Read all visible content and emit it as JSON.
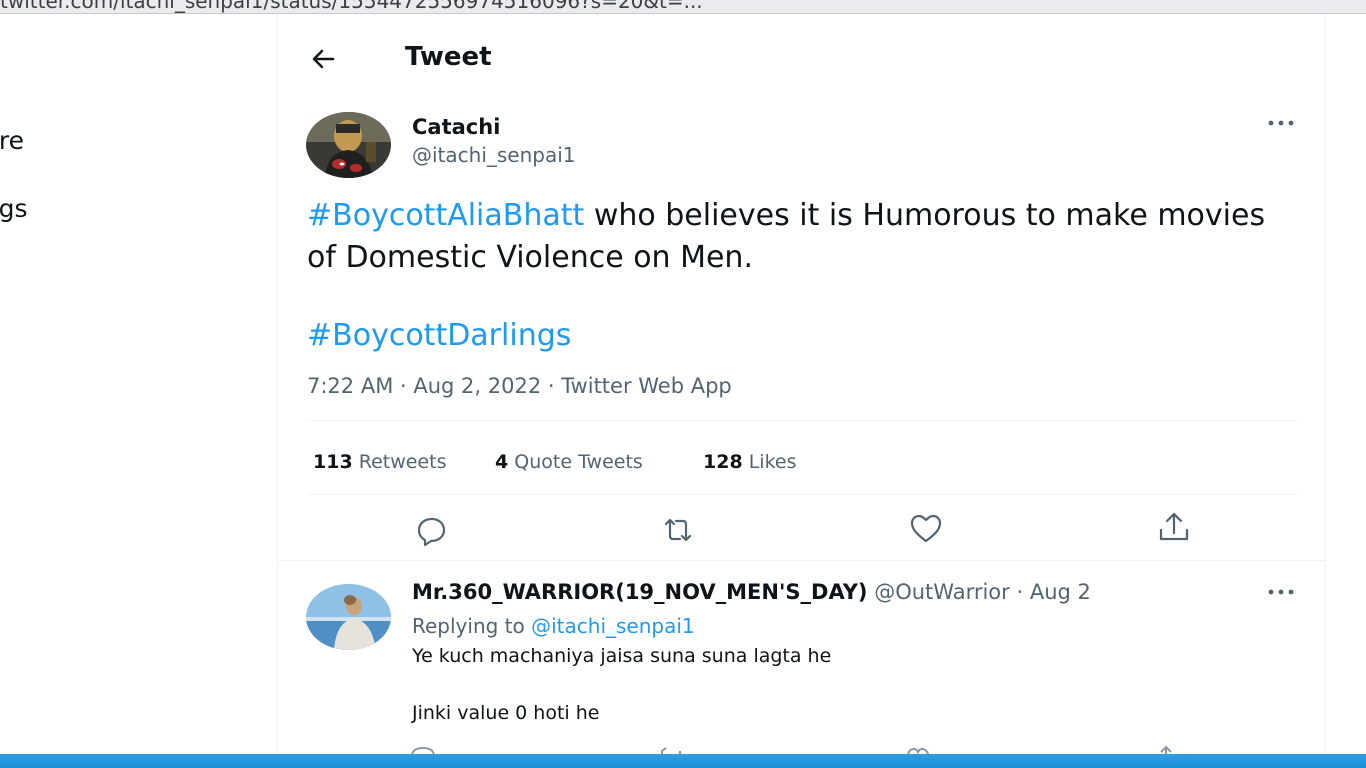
{
  "browser": {
    "url": "twitter.com/itachi_senpai1/status/1554472556974516096?s=20&t=..."
  },
  "left_nav": {
    "items": [
      {
        "label": "More"
      },
      {
        "label": "Settings"
      }
    ]
  },
  "header": {
    "title": "Tweet",
    "back_icon": "arrow-left-icon"
  },
  "tweet": {
    "author_name": "Catachi",
    "author_handle": "@itachi_senpai1",
    "hashtag1": "#BoycottAliaBhatt",
    "text_part1": " who believes it is Humorous to make movies of Domestic Violence on Men.",
    "hashtag2": "#BoycottDarlings",
    "meta": "7:22 AM · Aug 2, 2022 · Twitter Web App",
    "stats": {
      "retweets_count": "113",
      "retweets_label": "Retweets",
      "quotes_count": "4",
      "quotes_label": "Quote Tweets",
      "likes_count": "128",
      "likes_label": "Likes"
    },
    "actions": [
      "reply-icon",
      "retweet-icon",
      "like-icon",
      "share-icon"
    ]
  },
  "reply": {
    "name": "Mr.360_WARRIOR(19_NOV_MEN'S_DAY)",
    "handle": "@OutWarrior",
    "separator": "·",
    "date": "Aug 2",
    "replying_prefix": "Replying to",
    "replying_to": "@itachi_senpai1",
    "line1": "Ye kuch machaniya jaisa suna suna lagta he",
    "line2": "Jinki value 0 hoti he"
  },
  "colors": {
    "accent": "#1d9bf0",
    "secondary_text": "#536471",
    "primary_text": "#0f1419",
    "taskbar": "#1c8fd6"
  }
}
